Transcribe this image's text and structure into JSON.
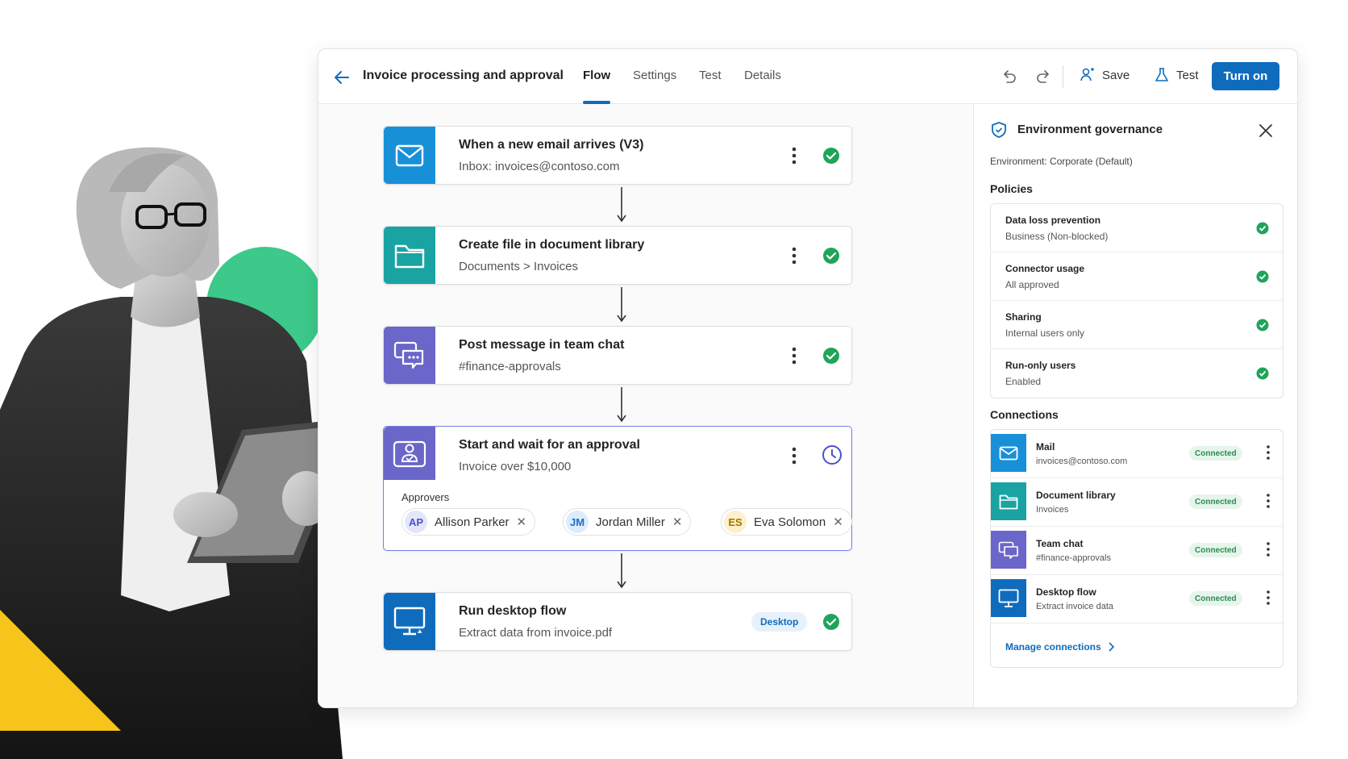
{
  "header": {
    "title": "Invoice processing and approval",
    "tabs": [
      {
        "label": "Flow",
        "active": true
      },
      {
        "label": "Settings",
        "active": false
      },
      {
        "label": "Test",
        "active": false
      },
      {
        "label": "Details",
        "active": false
      }
    ],
    "save_label": "Save",
    "test_label": "Test",
    "turn_on_label": "Turn on"
  },
  "flow": {
    "steps": [
      {
        "title": "When a new email arrives (V3)",
        "subtitle": "Inbox: invoices@contoso.com",
        "icon": "mail-icon",
        "color": "#1890d8",
        "status": "success"
      },
      {
        "title": "Create file in document library",
        "subtitle": "Documents > Invoices",
        "icon": "folder-icon",
        "color": "#1aa3a3",
        "status": "success"
      },
      {
        "title": "Post message in team chat",
        "subtitle": "#finance-approvals",
        "icon": "chat-icon",
        "color": "#6b66c9",
        "status": "success"
      },
      {
        "title": "Start and wait for an approval",
        "subtitle": "Invoice over $10,000",
        "icon": "approval-icon",
        "color": "#6b66c9",
        "status": "pending"
      },
      {
        "title": "Run desktop flow",
        "subtitle": "Extract data from invoice.pdf",
        "icon": "desktop-icon",
        "color": "#0f6cbd",
        "status": "success",
        "tag": "Desktop"
      }
    ],
    "approvers_label": "Approvers",
    "approvers": [
      {
        "initials": "AP",
        "name": "Allison Parker",
        "bg": "#e3e6fb",
        "fg": "#4a52c9"
      },
      {
        "initials": "JM",
        "name": "Jordan Miller",
        "bg": "#dcecfb",
        "fg": "#1a6fc4"
      },
      {
        "initials": "ES",
        "name": "Eva Solomon",
        "bg": "#fdf0cc",
        "fg": "#a37400"
      }
    ]
  },
  "panel": {
    "title": "Environment governance",
    "environment": "Environment: Corporate (Default)",
    "policies_heading": "Policies",
    "policies": [
      {
        "name": "Data loss prevention",
        "value": "Business (Non-blocked)"
      },
      {
        "name": "Connector usage",
        "value": "All approved"
      },
      {
        "name": "Sharing",
        "value": "Internal users only"
      },
      {
        "name": "Run-only users",
        "value": "Enabled"
      }
    ],
    "connections_heading": "Connections",
    "connections": [
      {
        "name": "Mail",
        "detail": "invoices@contoso.com",
        "status": "Connected",
        "icon": "mail-icon",
        "color": "#1890d8"
      },
      {
        "name": "Document library",
        "detail": "Invoices",
        "status": "Connected",
        "icon": "folder-icon",
        "color": "#1aa3a3"
      },
      {
        "name": "Team chat",
        "detail": "#finance-approvals",
        "status": "Connected",
        "icon": "chat-icon",
        "color": "#6b66c9"
      },
      {
        "name": "Desktop flow",
        "detail": "Extract invoice data",
        "status": "Connected",
        "icon": "desktop-icon",
        "color": "#0f6cbd"
      }
    ],
    "manage_label": "Manage connections"
  },
  "colors": {
    "accent": "#0f6cbd",
    "success": "#1fa55a",
    "decor_green": "#3cc98a",
    "decor_yellow": "#f7c41a"
  }
}
